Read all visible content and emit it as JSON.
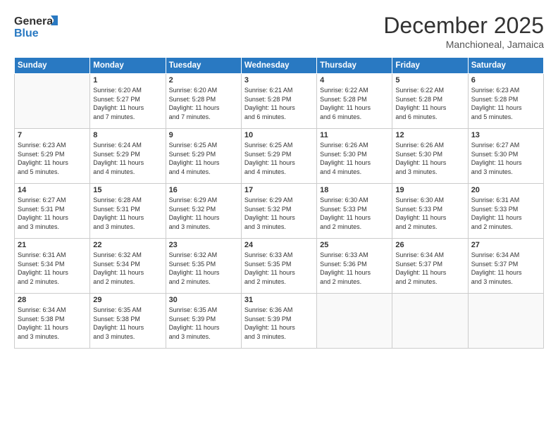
{
  "header": {
    "logo_line1": "General",
    "logo_line2": "Blue",
    "month_title": "December 2025",
    "location": "Manchioneal, Jamaica"
  },
  "days_of_week": [
    "Sunday",
    "Monday",
    "Tuesday",
    "Wednesday",
    "Thursday",
    "Friday",
    "Saturday"
  ],
  "weeks": [
    [
      {
        "day": "",
        "info": ""
      },
      {
        "day": "1",
        "info": "Sunrise: 6:20 AM\nSunset: 5:27 PM\nDaylight: 11 hours\nand 7 minutes."
      },
      {
        "day": "2",
        "info": "Sunrise: 6:20 AM\nSunset: 5:28 PM\nDaylight: 11 hours\nand 7 minutes."
      },
      {
        "day": "3",
        "info": "Sunrise: 6:21 AM\nSunset: 5:28 PM\nDaylight: 11 hours\nand 6 minutes."
      },
      {
        "day": "4",
        "info": "Sunrise: 6:22 AM\nSunset: 5:28 PM\nDaylight: 11 hours\nand 6 minutes."
      },
      {
        "day": "5",
        "info": "Sunrise: 6:22 AM\nSunset: 5:28 PM\nDaylight: 11 hours\nand 6 minutes."
      },
      {
        "day": "6",
        "info": "Sunrise: 6:23 AM\nSunset: 5:28 PM\nDaylight: 11 hours\nand 5 minutes."
      }
    ],
    [
      {
        "day": "7",
        "info": "Sunrise: 6:23 AM\nSunset: 5:29 PM\nDaylight: 11 hours\nand 5 minutes."
      },
      {
        "day": "8",
        "info": "Sunrise: 6:24 AM\nSunset: 5:29 PM\nDaylight: 11 hours\nand 4 minutes."
      },
      {
        "day": "9",
        "info": "Sunrise: 6:25 AM\nSunset: 5:29 PM\nDaylight: 11 hours\nand 4 minutes."
      },
      {
        "day": "10",
        "info": "Sunrise: 6:25 AM\nSunset: 5:29 PM\nDaylight: 11 hours\nand 4 minutes."
      },
      {
        "day": "11",
        "info": "Sunrise: 6:26 AM\nSunset: 5:30 PM\nDaylight: 11 hours\nand 4 minutes."
      },
      {
        "day": "12",
        "info": "Sunrise: 6:26 AM\nSunset: 5:30 PM\nDaylight: 11 hours\nand 3 minutes."
      },
      {
        "day": "13",
        "info": "Sunrise: 6:27 AM\nSunset: 5:30 PM\nDaylight: 11 hours\nand 3 minutes."
      }
    ],
    [
      {
        "day": "14",
        "info": "Sunrise: 6:27 AM\nSunset: 5:31 PM\nDaylight: 11 hours\nand 3 minutes."
      },
      {
        "day": "15",
        "info": "Sunrise: 6:28 AM\nSunset: 5:31 PM\nDaylight: 11 hours\nand 3 minutes."
      },
      {
        "day": "16",
        "info": "Sunrise: 6:29 AM\nSunset: 5:32 PM\nDaylight: 11 hours\nand 3 minutes."
      },
      {
        "day": "17",
        "info": "Sunrise: 6:29 AM\nSunset: 5:32 PM\nDaylight: 11 hours\nand 3 minutes."
      },
      {
        "day": "18",
        "info": "Sunrise: 6:30 AM\nSunset: 5:33 PM\nDaylight: 11 hours\nand 2 minutes."
      },
      {
        "day": "19",
        "info": "Sunrise: 6:30 AM\nSunset: 5:33 PM\nDaylight: 11 hours\nand 2 minutes."
      },
      {
        "day": "20",
        "info": "Sunrise: 6:31 AM\nSunset: 5:33 PM\nDaylight: 11 hours\nand 2 minutes."
      }
    ],
    [
      {
        "day": "21",
        "info": "Sunrise: 6:31 AM\nSunset: 5:34 PM\nDaylight: 11 hours\nand 2 minutes."
      },
      {
        "day": "22",
        "info": "Sunrise: 6:32 AM\nSunset: 5:34 PM\nDaylight: 11 hours\nand 2 minutes."
      },
      {
        "day": "23",
        "info": "Sunrise: 6:32 AM\nSunset: 5:35 PM\nDaylight: 11 hours\nand 2 minutes."
      },
      {
        "day": "24",
        "info": "Sunrise: 6:33 AM\nSunset: 5:35 PM\nDaylight: 11 hours\nand 2 minutes."
      },
      {
        "day": "25",
        "info": "Sunrise: 6:33 AM\nSunset: 5:36 PM\nDaylight: 11 hours\nand 2 minutes."
      },
      {
        "day": "26",
        "info": "Sunrise: 6:34 AM\nSunset: 5:37 PM\nDaylight: 11 hours\nand 2 minutes."
      },
      {
        "day": "27",
        "info": "Sunrise: 6:34 AM\nSunset: 5:37 PM\nDaylight: 11 hours\nand 3 minutes."
      }
    ],
    [
      {
        "day": "28",
        "info": "Sunrise: 6:34 AM\nSunset: 5:38 PM\nDaylight: 11 hours\nand 3 minutes."
      },
      {
        "day": "29",
        "info": "Sunrise: 6:35 AM\nSunset: 5:38 PM\nDaylight: 11 hours\nand 3 minutes."
      },
      {
        "day": "30",
        "info": "Sunrise: 6:35 AM\nSunset: 5:39 PM\nDaylight: 11 hours\nand 3 minutes."
      },
      {
        "day": "31",
        "info": "Sunrise: 6:36 AM\nSunset: 5:39 PM\nDaylight: 11 hours\nand 3 minutes."
      },
      {
        "day": "",
        "info": ""
      },
      {
        "day": "",
        "info": ""
      },
      {
        "day": "",
        "info": ""
      }
    ]
  ]
}
